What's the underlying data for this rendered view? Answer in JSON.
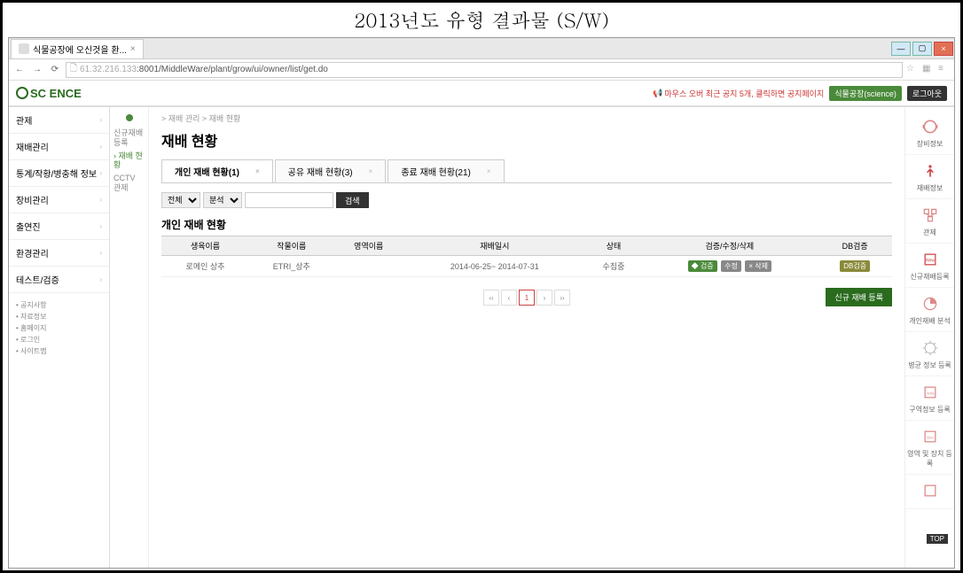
{
  "doc_title": "2013년도 유형 결과물 (S/W)",
  "browser": {
    "tab_title": "식물공장에 오신것을 환...",
    "url_prefix": "61.32.216.133",
    "url_rest": ":8001/MiddleWare/plant/grow/ui/owner/list/get.do"
  },
  "header": {
    "logo_text": "SC ENCE",
    "notice": "마우스 오버 최근 공지 5개, 클릭하면 공지페이지",
    "btn1": "식물공장(science)",
    "btn2": "로그아웃"
  },
  "left_nav": {
    "items": [
      {
        "label": "관제"
      },
      {
        "label": "재배관리"
      },
      {
        "label": "통계/작황/병충해 정보"
      },
      {
        "label": "장비관리"
      },
      {
        "label": "출연진"
      },
      {
        "label": "환경관리"
      },
      {
        "label": "테스트/검증"
      }
    ],
    "links": [
      "공지사항",
      "자료정보",
      "홈페이지",
      "로그인",
      "사이트맵"
    ]
  },
  "sub_nav": {
    "items": [
      {
        "label": "신규재배 등록"
      },
      {
        "label": "재배 현황",
        "active": true
      },
      {
        "label": "CCTV 관제"
      }
    ]
  },
  "main": {
    "breadcrumb": "> 재배 관리 > 재배 현황",
    "title": "재배 현황",
    "tabs": [
      {
        "label": "개인 재배 현황(1)",
        "active": true
      },
      {
        "label": "공유 재배 현황(3)"
      },
      {
        "label": "종료 재배 현황(21)"
      }
    ],
    "filter": {
      "sel1": "전체",
      "sel2": "분석",
      "search_btn": "검색"
    },
    "section_title": "개인 재배 현황",
    "table": {
      "headers": [
        "생육이름",
        "작물이름",
        "영역이름",
        "재배일시",
        "상태",
        "검증/수정/삭제",
        "DB검증"
      ],
      "rows": [
        {
          "col1": "로메인 상추",
          "col2": "ETRI_상추",
          "col3": "",
          "col4": "2014-06-25~ 2014-07-31",
          "col5": "수집중",
          "verify": "◆ 검증",
          "edit": "수정",
          "delete": "× 삭제",
          "db": "DB검증"
        }
      ]
    },
    "pagination": {
      "first": "‹‹",
      "prev": "‹",
      "page": "1",
      "next": "›",
      "last": "››"
    },
    "new_reg_btn": "신규 재배 등록"
  },
  "right_rail": [
    {
      "name": "device-info",
      "label": "장비정보",
      "color": "#d88"
    },
    {
      "name": "grow-info",
      "label": "재배정보",
      "color": "#c44"
    },
    {
      "name": "control",
      "label": "관제",
      "color": "#d88"
    },
    {
      "name": "new-reg",
      "label": "신규재배등록",
      "color": "#c44"
    },
    {
      "name": "personal-analysis",
      "label": "개인재배 분석",
      "color": "#d88"
    },
    {
      "name": "pest-reg",
      "label": "병균 정보 등록",
      "color": "#aaa"
    },
    {
      "name": "area-reg",
      "label": "구역정보 등록",
      "color": "#d88"
    },
    {
      "name": "device-reg",
      "label": "영역 및 장치 등록",
      "color": "#d88"
    },
    {
      "name": "extra",
      "label": "",
      "color": "#d88"
    }
  ],
  "top_badge": "TOP"
}
